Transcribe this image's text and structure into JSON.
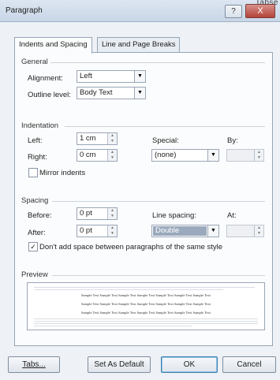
{
  "window": {
    "title": "Paragraph",
    "top_corner_text": "Tabse",
    "help_label": "?",
    "close_label": "X"
  },
  "tabs": [
    {
      "label": "Indents and Spacing",
      "active": true
    },
    {
      "label": "Line and Page Breaks",
      "active": false
    }
  ],
  "general": {
    "section_title": "General",
    "alignment_label": "Alignment:",
    "alignment_value": "Left",
    "outline_label": "Outline level:",
    "outline_value": "Body Text"
  },
  "indentation": {
    "section_title": "Indentation",
    "left_label": "Left:",
    "left_value": "1 cm",
    "right_label": "Right:",
    "right_value": "0 cm",
    "special_label": "Special:",
    "special_value": "(none)",
    "by_label": "By:",
    "by_value": "",
    "mirror_label": "Mirror indents",
    "mirror_checked": false
  },
  "spacing": {
    "section_title": "Spacing",
    "before_label": "Before:",
    "before_value": "0 pt",
    "after_label": "After:",
    "after_value": "0 pt",
    "line_spacing_label": "Line spacing:",
    "line_spacing_value": "Double",
    "at_label": "At:",
    "at_value": "",
    "dont_add_label": "Don't add space between paragraphs of the same style",
    "dont_add_checked": true
  },
  "preview": {
    "section_title": "Preview",
    "sample_lines": [
      "Sample Text Sample Text Sample Text Sample Text Sample Text Sample Text Sample Text",
      "Sample Text Sample Text Sample Text Sample Text Sample Text Sample Text Sample Text",
      "Sample Text Sample Text Sample Text Sample Text Sample Text Sample Text Sample Text"
    ]
  },
  "buttons": {
    "tabs": "Tabs...",
    "set_default": "Set As Default",
    "ok": "OK",
    "cancel": "Cancel"
  },
  "icons": {
    "dropdown": "chevron-down-icon",
    "spinner": "spinner-arrows-icon",
    "check": "checkmark-icon"
  }
}
